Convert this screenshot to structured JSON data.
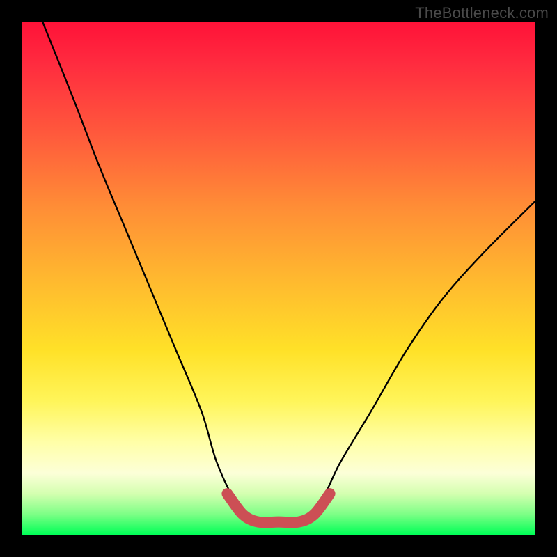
{
  "watermark": "TheBottleneck.com",
  "chart_data": {
    "type": "line",
    "title": "",
    "xlabel": "",
    "ylabel": "",
    "xlim": [
      0,
      100
    ],
    "ylim": [
      0,
      100
    ],
    "series": [
      {
        "name": "black-curve",
        "x": [
          4,
          10,
          15,
          20,
          25,
          30,
          35,
          38,
          42,
          46,
          50,
          54,
          58,
          62,
          68,
          75,
          82,
          90,
          100
        ],
        "values": [
          100,
          85,
          72,
          60,
          48,
          36,
          24,
          14,
          6,
          3,
          3,
          3,
          6,
          14,
          24,
          36,
          46,
          55,
          65
        ]
      },
      {
        "name": "red-trough",
        "x": [
          40,
          43,
          46,
          50,
          54,
          57,
          60
        ],
        "values": [
          8,
          4,
          2.5,
          2.5,
          2.5,
          4,
          8
        ]
      }
    ],
    "colors": {
      "black-curve": "#000000",
      "red-trough": "#cc4f55"
    }
  }
}
